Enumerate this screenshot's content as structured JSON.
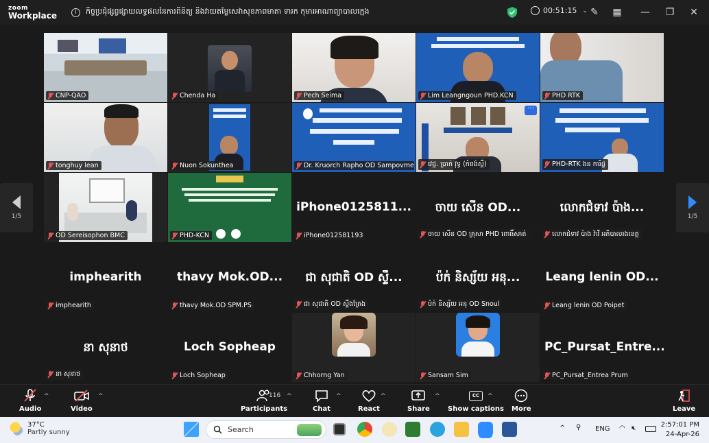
{
  "titlebar": {
    "brand_line1": "zoom",
    "brand_line2": "Workplace",
    "meeting_title": "កិច្ចប្រជុំផ្សព្វផ្សាយលទ្ធផលនៃការពិនិត្យ និងវាយតម្លៃសេវាសុខភាពមាតា ទារក កុមារអាណាព្យាបាលក្មេង",
    "timer": "00:51:15"
  },
  "gallery": {
    "page_left": "1/5",
    "page_right": "1/5",
    "tiles": [
      {
        "name": "CNP-QAO",
        "big": "",
        "kind": "room"
      },
      {
        "name": "Chenda Ha",
        "big": "",
        "kind": "portrait"
      },
      {
        "name": "Pech Seima",
        "big": "",
        "kind": "webcam-woman",
        "active": true
      },
      {
        "name": "Lim Leangngoun PHD.KCN",
        "big": "",
        "kind": "banner-man"
      },
      {
        "name": "PHD RTK",
        "big": "",
        "kind": "webcam-man"
      },
      {
        "name": "tonghuy lean",
        "big": "",
        "kind": "webcam-man2"
      },
      {
        "name": "Nuon Sokunthea",
        "big": "",
        "kind": "banner-small"
      },
      {
        "name": "Dr. Kruorch Rapho OD Sampovmeas",
        "big": "",
        "kind": "banner"
      },
      {
        "name": "វេជ្ជ. ប្រាក់ វុទ្ធ (កំពង់ស្ពឺ)",
        "big": "",
        "kind": "office",
        "more": "···"
      },
      {
        "name": "PHD-RTK ងន ការិដ្ឋ",
        "big": "",
        "kind": "banner-man2"
      },
      {
        "name": "OD Sereisophon BMC",
        "big": "",
        "kind": "meeting-room"
      },
      {
        "name": "PHD-KCN",
        "big": "",
        "kind": "green-slide"
      },
      {
        "name": "iPhone012581193",
        "big": "iPhone0125811...",
        "kind": "text"
      },
      {
        "name": "ចាយ សើន OD គ្រុសា PHD ពោធិ៍សាត់",
        "big": "ចាយ សើន OD...",
        "kind": "text"
      },
      {
        "name": "លោកជំទាវ ប៉ាង វ៉ាវី អភិបាលរងខេត្ត",
        "big": "លោកជំទាវ ប៉ាង...",
        "kind": "text"
      },
      {
        "name": "imphearith",
        "big": "imphearith",
        "kind": "text"
      },
      {
        "name": "thavy Mok.OD SPM.PS",
        "big": "thavy Mok.OD...",
        "kind": "text"
      },
      {
        "name": "ជា សុជាតិ OD ស្ទឹងត្រែង",
        "big": "ជា សុជាតិ OD ស្ទឹ...",
        "kind": "text"
      },
      {
        "name": "ប៉ក់ និស្ស័យ អនុ OD Snoul",
        "big": "ប៉ក់ និស្ស័យ អនុ...",
        "kind": "text"
      },
      {
        "name": "Leang lenin OD Poipet",
        "big": "Leang lenin OD...",
        "kind": "text"
      },
      {
        "name": "នា សុនាថ",
        "big": "នា សុនាថ",
        "kind": "text"
      },
      {
        "name": "Loch Sopheap",
        "big": "Loch Sopheap",
        "kind": "text"
      },
      {
        "name": "Chhorng Yan",
        "big": "",
        "kind": "avatar-woman"
      },
      {
        "name": "Sansam Sim",
        "big": "",
        "kind": "avatar-woman2"
      },
      {
        "name": "PC_Pursat_Entrea Prum",
        "big": "PC_Pursat_Entre...",
        "kind": "text"
      }
    ]
  },
  "toolbar": {
    "audio": "Audio",
    "video": "Video",
    "participants": "Participants",
    "participants_count": "116",
    "chat": "Chat",
    "react": "React",
    "share": "Share",
    "captions": "Show captions",
    "captions_badge": "CC",
    "more": "More",
    "leave": "Leave"
  },
  "taskbar": {
    "temperature": "37°C",
    "weather": "Partly sunny",
    "search_placeholder": "Search",
    "lang": "ENG",
    "time": "2:57:01 PM",
    "date": "24-Apr-26"
  }
}
